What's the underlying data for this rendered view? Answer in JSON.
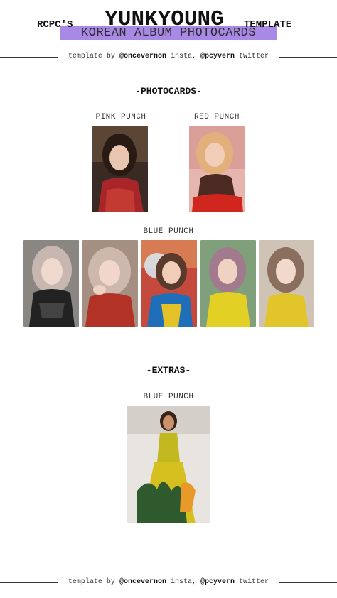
{
  "header": {
    "prefix": "RCPC'S",
    "title": "YUNKYOUNG",
    "suffix": "TEMPLATE",
    "subtitle": "KOREAN ALBUM PHOTOCARDS",
    "highlight_color": "#a889e6"
  },
  "credit": {
    "template_by": "template by",
    "insta_handle": "@oncevernon",
    "insta_label": "insta,",
    "twitter_handle": "@pcyvern",
    "twitter_label": "twitter"
  },
  "photocards": {
    "title": "-PHOTOCARDS-",
    "versions": [
      {
        "label": "PINK PUNCH",
        "cards": 1
      },
      {
        "label": "RED PUNCH",
        "cards": 1
      },
      {
        "label": "BLUE PUNCH",
        "cards": 5
      }
    ]
  },
  "extras": {
    "title": "-EXTRAS-",
    "label": "BLUE PUNCH"
  }
}
